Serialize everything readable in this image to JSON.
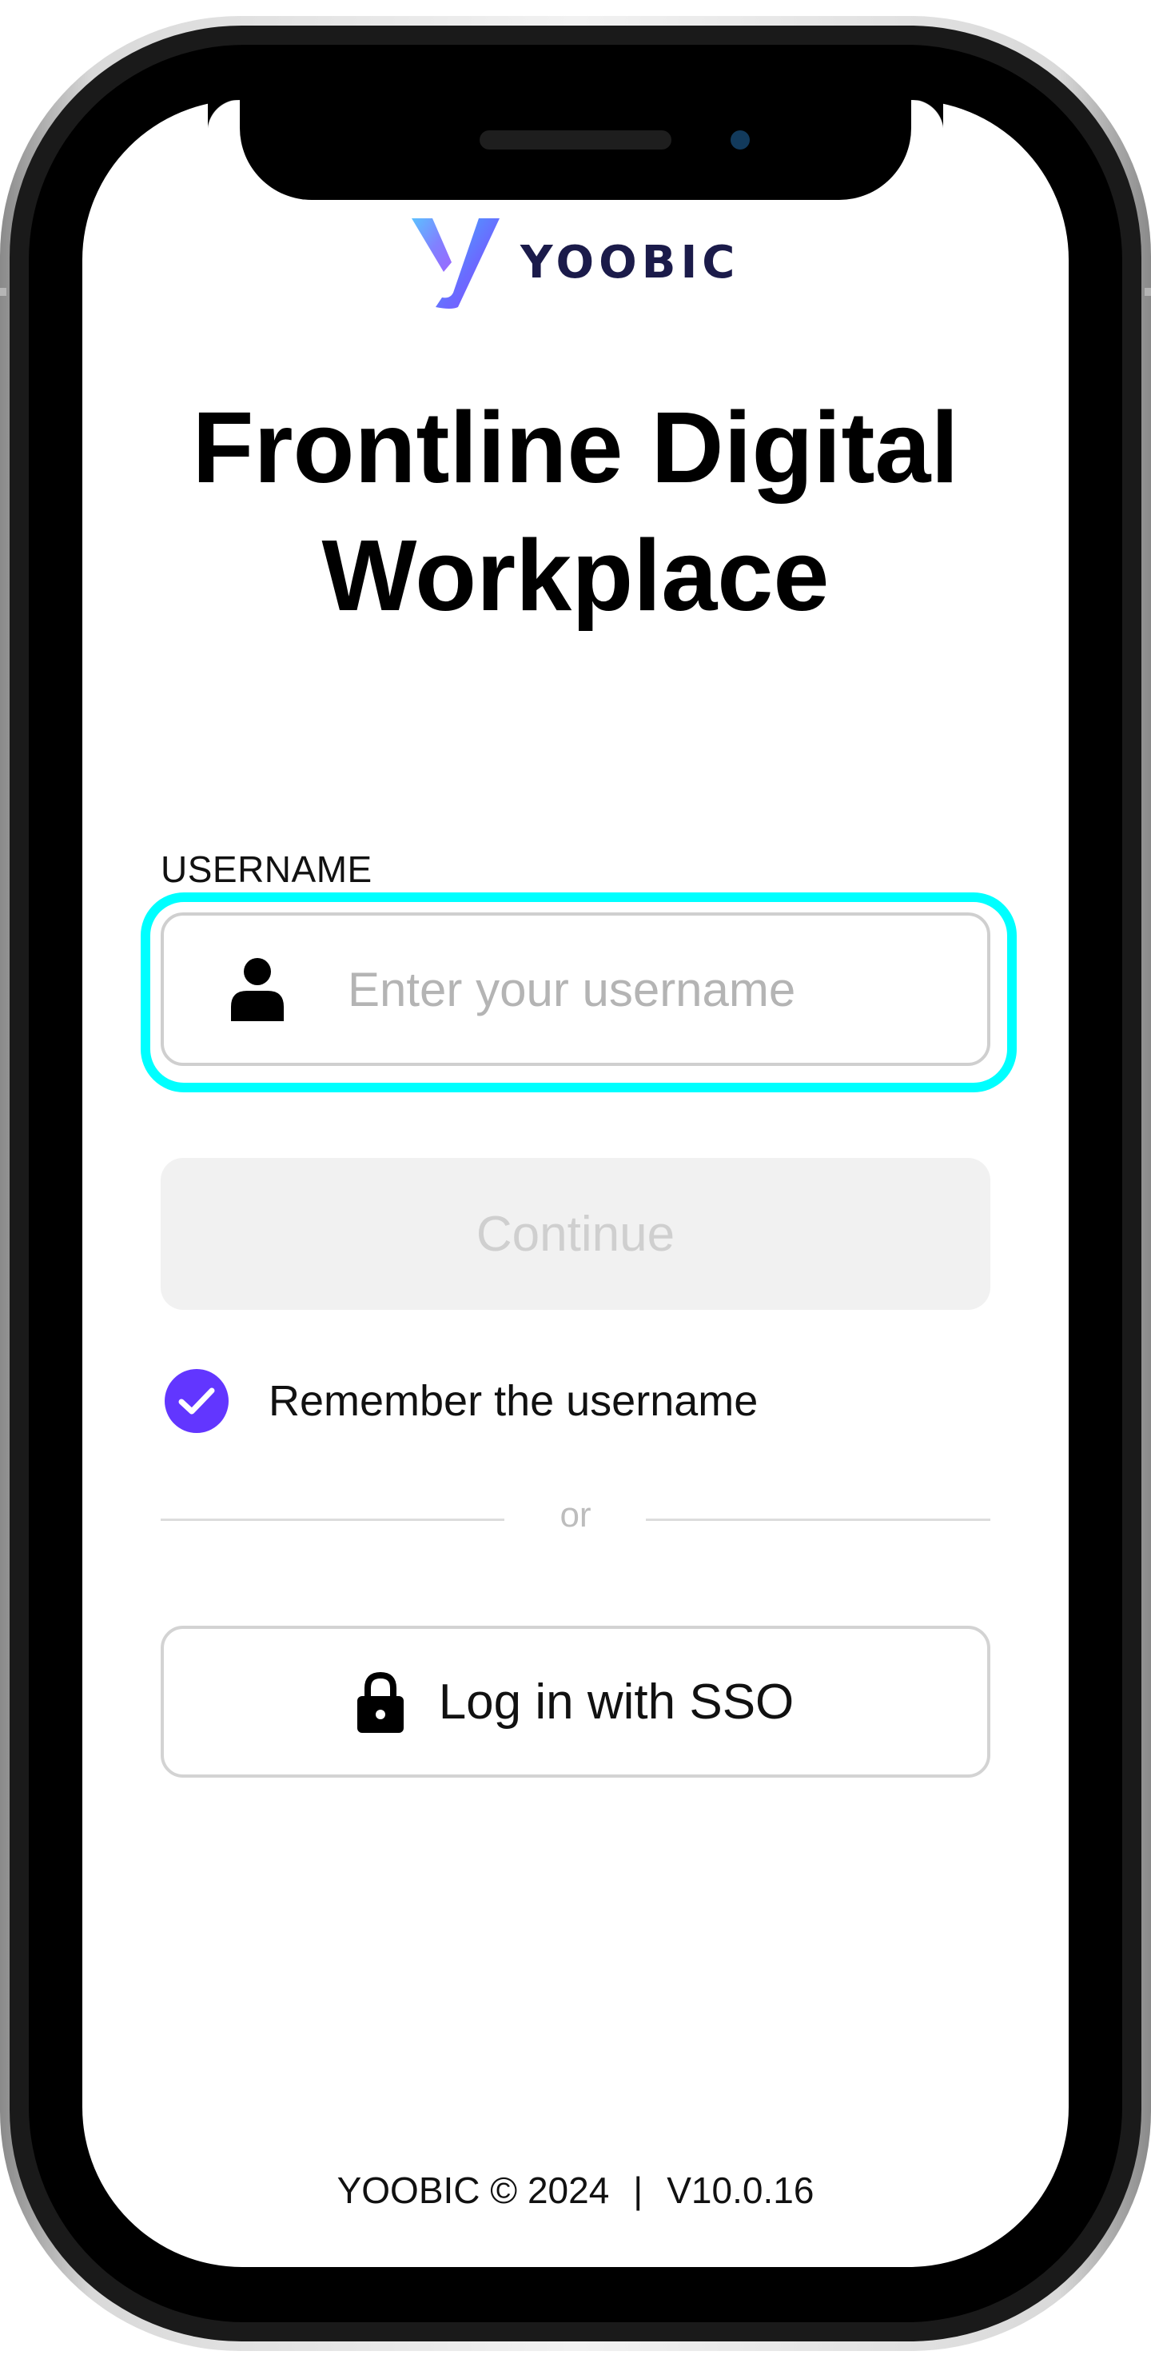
{
  "app": {
    "brand_name": "YOOBIC",
    "headline_line1": "Frontline Digital",
    "headline_line2": "Workplace"
  },
  "login": {
    "username_label": "USERNAME",
    "username_placeholder": "Enter your username",
    "username_value": "",
    "continue_label": "Continue",
    "remember_label": "Remember the username",
    "remember_checked": true,
    "divider_text": "or",
    "sso_label": "Log in with SSO"
  },
  "footer": {
    "copyright": "YOOBIC © 2024",
    "separator": "|",
    "version": "V10.0.16"
  },
  "icons": {
    "username_icon": "user-icon",
    "sso_icon": "lock-icon",
    "remember_icon": "checkmark-icon",
    "logo_icon": "yoobic-logo-icon"
  },
  "colors": {
    "accent": "#6236ff",
    "highlight": "#00ffff",
    "brand_text": "#1b1b4a",
    "disabled_bg": "#f1f1f1",
    "disabled_text": "#cfcfcf"
  }
}
